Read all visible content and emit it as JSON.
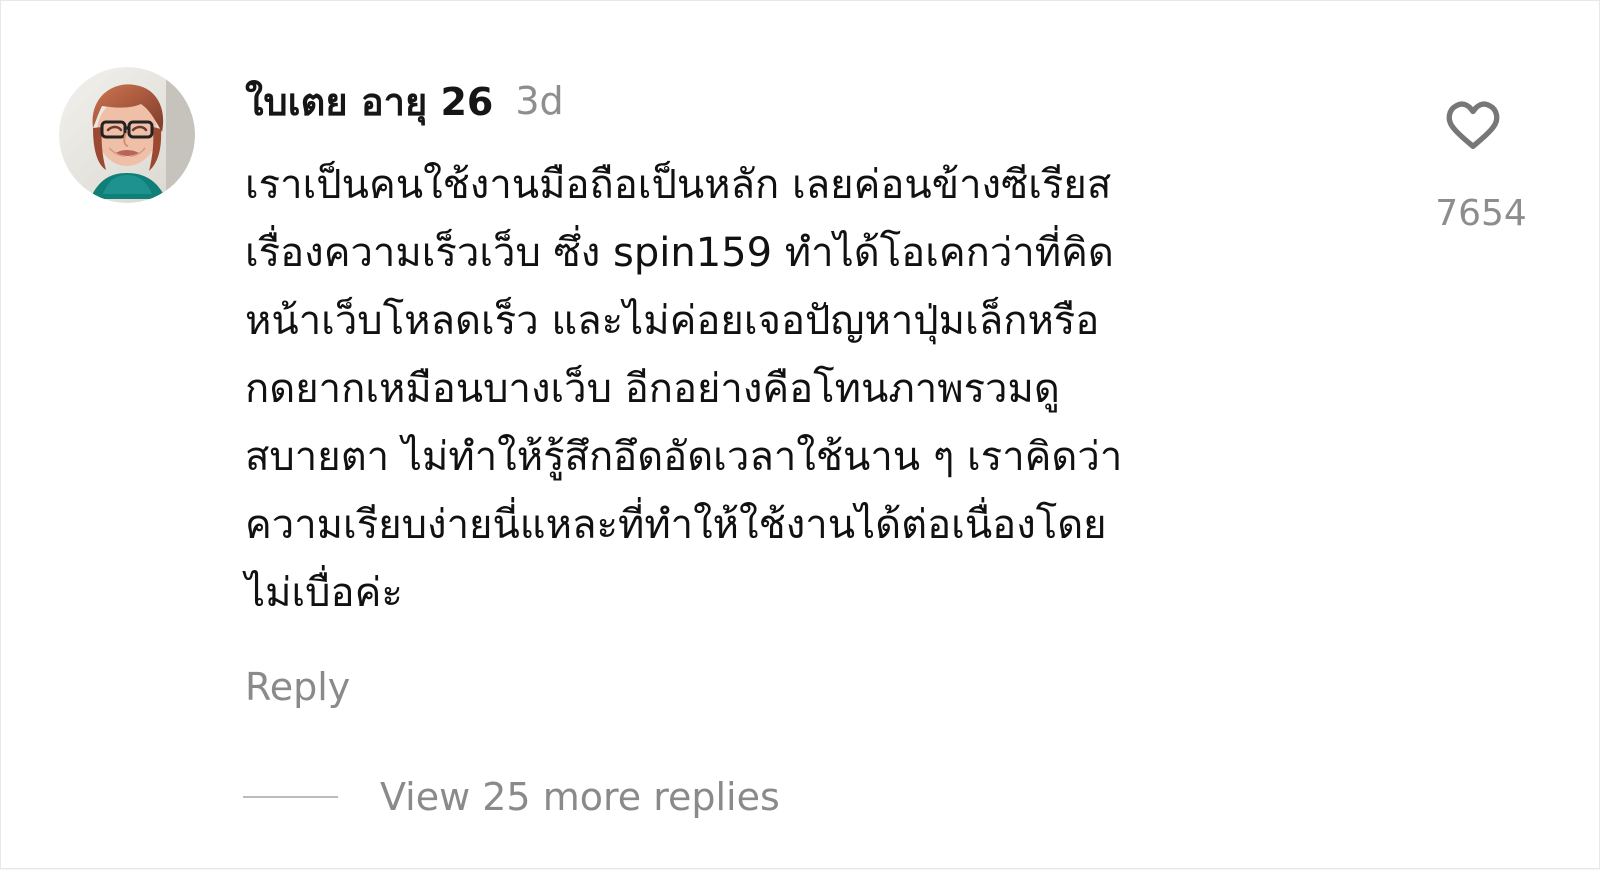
{
  "comment": {
    "username": "ใบเตย อายุ 26",
    "timestamp": "3d",
    "text": "เราเป็นคนใช้งานมือถือเป็นหลัก เลยค่อนข้างซีเรียส\nเรื่องความเร็วเว็บ ซึ่ง spin159 ทำได้โอเคกว่าที่คิด\nหน้าเว็บโหลดเร็ว และไม่ค่อยเจอปัญหาปุ่มเล็กหรือ\nกดยากเหมือนบางเว็บ อีกอย่างคือโทนภาพรวมดู\nสบายตา ไม่ทำให้รู้สึกอึดอัดเวลาใช้นาน ๆ เราคิดว่า\nความเรียบง่ายนี่แหละที่ทำให้ใช้งานได้ต่อเนื่องโดย\nไม่เบื่อค่ะ",
    "reply_label": "Reply",
    "view_replies_label": "View 25 more replies",
    "like_count": "7654",
    "avatar_icon": "user-avatar-icon",
    "like_icon": "heart-icon"
  },
  "colors": {
    "background": "#ffffff",
    "primary_text": "#111111",
    "secondary_text": "#8a8a8a",
    "heart_stroke": "#777777",
    "divider": "#bcbcbc"
  }
}
